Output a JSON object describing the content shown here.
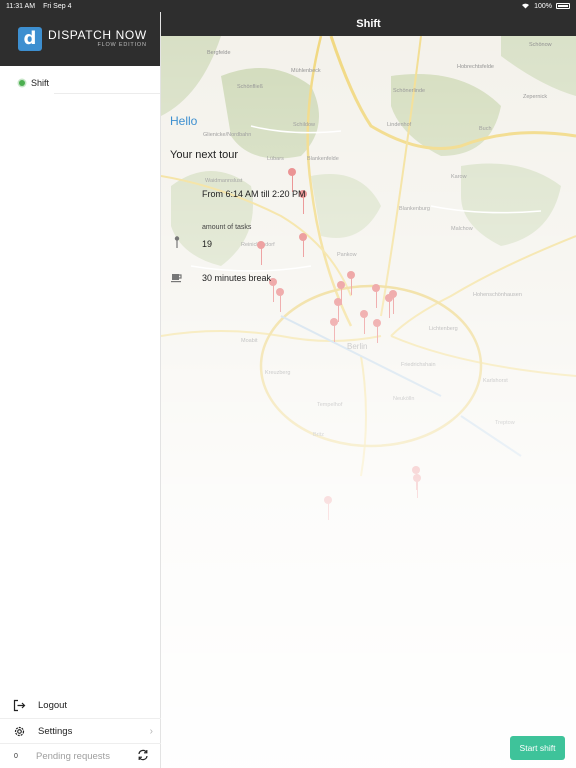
{
  "status_bar": {
    "time": "11:31 AM",
    "date": "Fri Sep 4",
    "wifi": "wifi-icon",
    "battery": "100%"
  },
  "header": {
    "title": "Shift"
  },
  "sidebar": {
    "logo_letter": "d",
    "logo_main": "DISPATCH NOW",
    "logo_sub": "FLOW EDITION",
    "items": [
      {
        "label": "Shift",
        "active": true
      }
    ],
    "bottom": {
      "logout_label": "Logout",
      "settings_label": "Settings",
      "pending_count": "0",
      "pending_label": "Pending requests"
    }
  },
  "tour": {
    "greeting": "Hello",
    "heading": "Your next tour",
    "time_range": "From 6:14 AM till 2:20 PM",
    "tasks_label": "amount of tasks",
    "tasks_value": "19",
    "break_text": "30 minutes break"
  },
  "map": {
    "labels": [
      "Bergfelde",
      "Schönow",
      "Mühlenbeck",
      "Hobrechtsfelde",
      "Schönfließ",
      "Schönerlinde",
      "Zepernick",
      "Schildow",
      "Lindenhof",
      "Buch",
      "Glienicke/Nordbahn",
      "Lübars",
      "Blankenfelde",
      "Karow",
      "Waidmannslust",
      "Blankenburg",
      "Malchow",
      "Reinickendorf",
      "Pankow",
      "Hohenschönhausen",
      "Moabit",
      "Berlin",
      "Lichtenberg",
      "Friedrichshain",
      "Kreuzberg",
      "Neukölln",
      "Karlshorst",
      "Tempelhof",
      "Treptow",
      "Britz"
    ],
    "pin_color": "#e57373"
  },
  "colors": {
    "accent": "#3d8fd0",
    "header_bg": "#2e2e2e",
    "start_button": "#3ec39a",
    "active_dot": "#4caf50"
  },
  "actions": {
    "start_shift_label": "Start shift"
  }
}
